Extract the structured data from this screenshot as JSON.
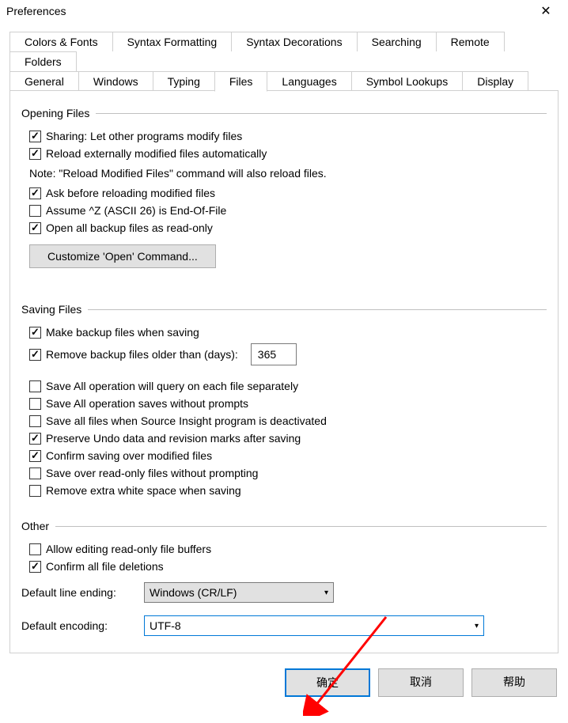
{
  "window": {
    "title": "Preferences"
  },
  "tabs": {
    "row1": [
      "Colors & Fonts",
      "Syntax Formatting",
      "Syntax Decorations",
      "Searching",
      "Remote",
      "Folders"
    ],
    "row2": [
      "General",
      "Windows",
      "Typing",
      "Files",
      "Languages",
      "Symbol Lookups",
      "Display"
    ],
    "active": "Files"
  },
  "opening": {
    "title": "Opening Files",
    "sharing": "Sharing: Let other programs modify files",
    "reload": "Reload externally modified files automatically",
    "note": "Note: \"Reload Modified Files\" command will also reload files.",
    "ask": "Ask before reloading modified files",
    "assume": "Assume ^Z (ASCII 26) is End-Of-File",
    "backupRO": "Open all backup files as read-only",
    "customizeBtn": "Customize 'Open' Command..."
  },
  "saving": {
    "title": "Saving Files",
    "mkbackup": "Make backup files when saving",
    "rmOlder": "Remove backup files older than (days):",
    "rmOlderValue": "365",
    "saveAllQuery": "Save All operation will query on each file separately",
    "saveAllNoPrompt": "Save All operation saves without prompts",
    "saveDeact": "Save all files when Source Insight program is deactivated",
    "preserveUndo": "Preserve Undo data and revision marks after saving",
    "confirmOver": "Confirm saving over modified files",
    "saveRO": "Save over read-only files without prompting",
    "rmWhite": "Remove extra white space when saving"
  },
  "other": {
    "title": "Other",
    "allowRO": "Allow editing read-only file buffers",
    "confirmDel": "Confirm all file deletions",
    "lineEndLabel": "Default line ending:",
    "lineEndValue": "Windows (CR/LF)",
    "encLabel": "Default encoding:",
    "encValue": "UTF-8"
  },
  "footer": {
    "ok": "确定",
    "cancel": "取消",
    "help": "帮助"
  }
}
